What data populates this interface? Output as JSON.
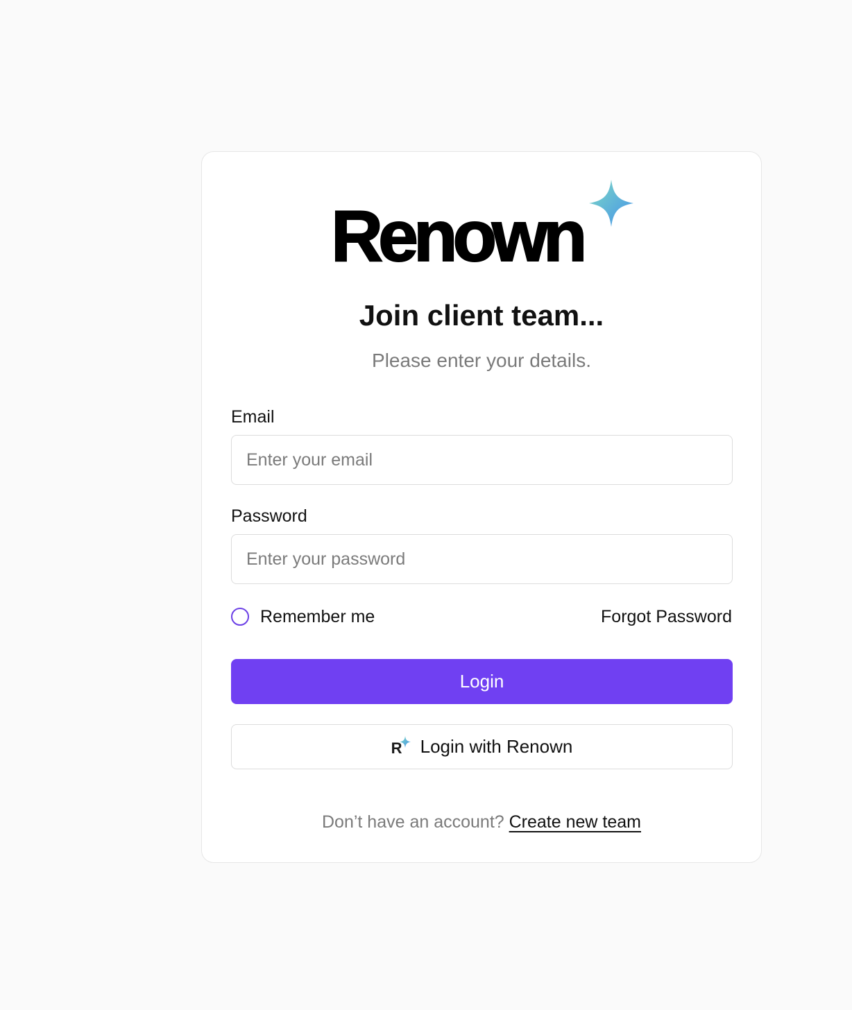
{
  "logo": {
    "wordmark": "Renown",
    "star_gradient": [
      "#74d3c9",
      "#4a9be8"
    ]
  },
  "header": {
    "title": "Join client team...",
    "subtitle": "Please enter your details."
  },
  "form": {
    "email_label": "Email",
    "email_placeholder": "Enter your email",
    "email_value": "",
    "password_label": "Password",
    "password_placeholder": "Enter your password",
    "password_value": "",
    "remember_label": "Remember me",
    "remember_checked": false,
    "forgot_label": "Forgot Password"
  },
  "actions": {
    "login_label": "Login",
    "login_with_label": "Login with Renown",
    "login_with_icon_letter": "R"
  },
  "footer": {
    "prompt": "Don’t have an account?",
    "link_label": "Create new team"
  },
  "colors": {
    "accent": "#7040f2",
    "page_background": "#fafafa",
    "radio_border": "#6b3fe6"
  }
}
